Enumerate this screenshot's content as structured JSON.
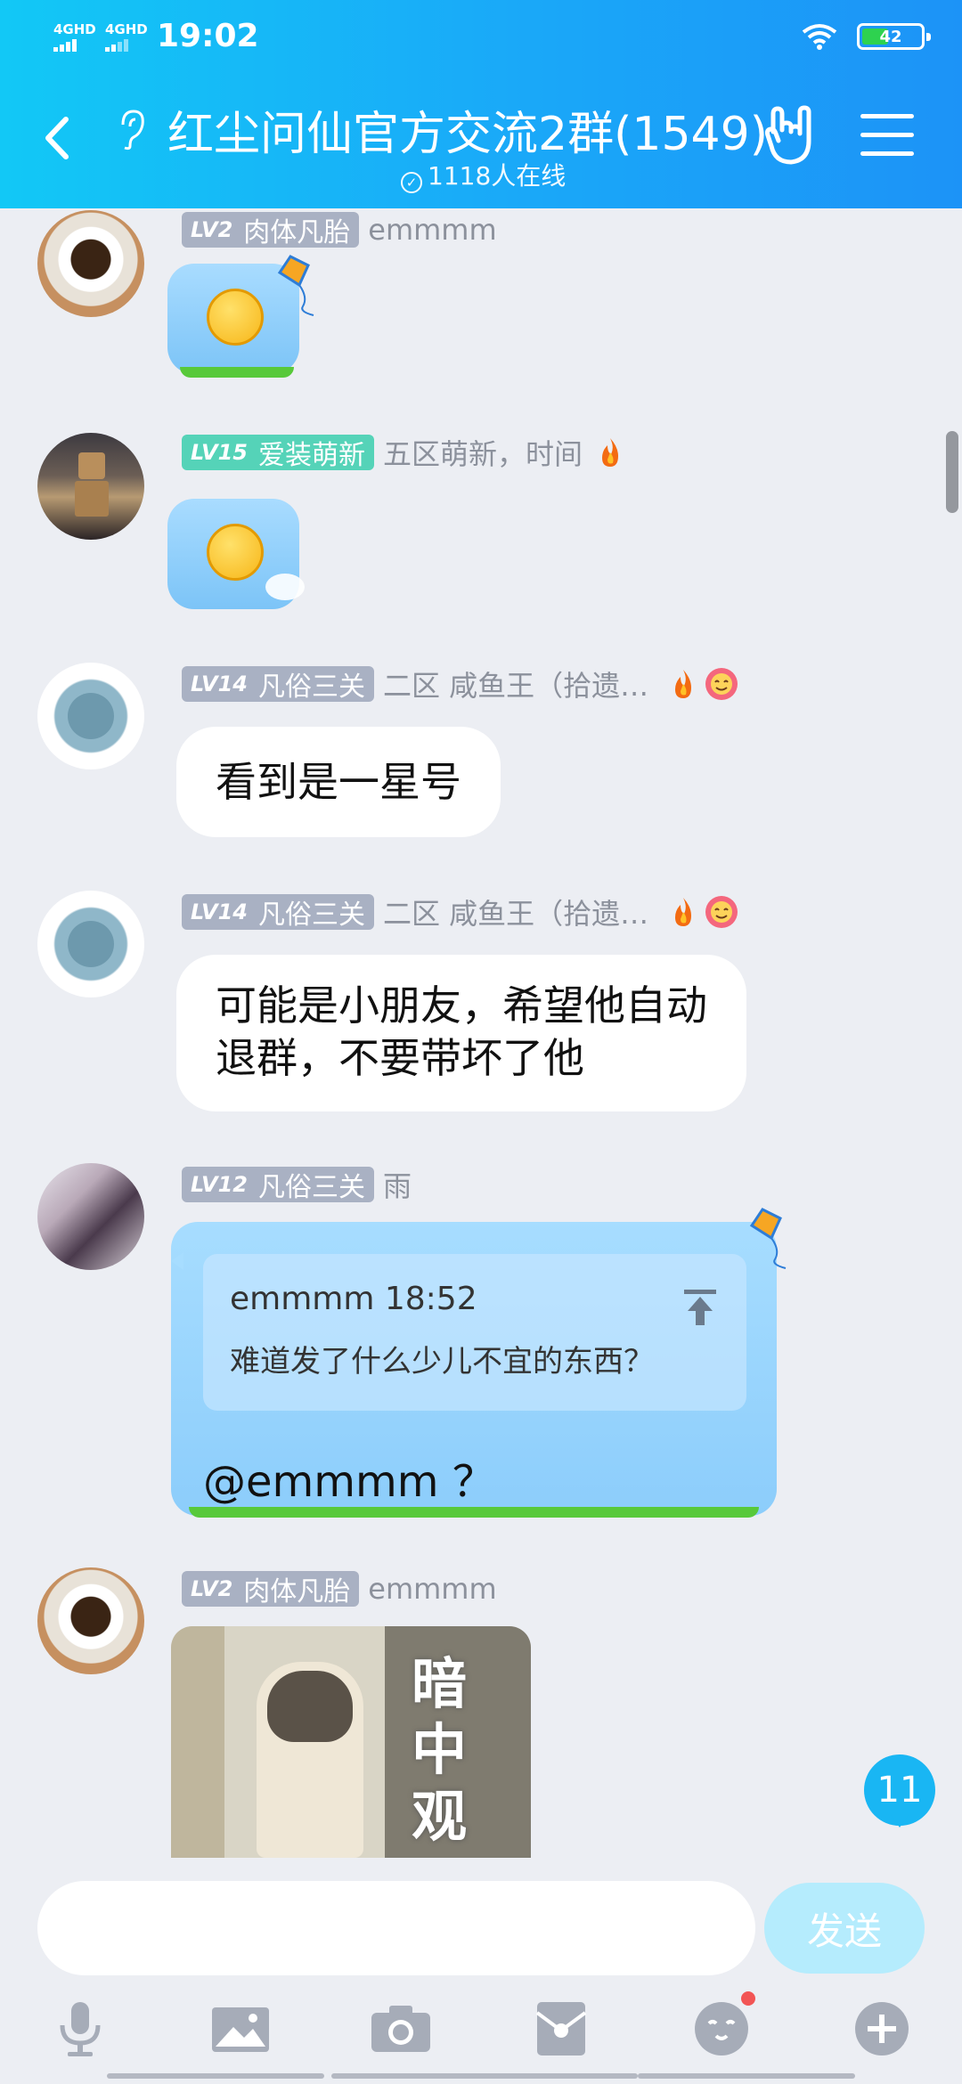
{
  "status_bar": {
    "signal_1": "4GHD",
    "signal_2": "4GHD",
    "time": "19:02",
    "battery": "42"
  },
  "header": {
    "title": "红尘问仙官方交流2群(1549)",
    "online_text": "1118人在线"
  },
  "messages": [
    {
      "level": "LV2",
      "title": "肉体凡胎",
      "nick": "emmmm",
      "type": "sticker"
    },
    {
      "level": "LV15",
      "title": "爱装萌新",
      "nick": "五区萌新，时间",
      "type": "sticker"
    },
    {
      "level": "LV14",
      "title": "凡俗三关",
      "nick": "二区 咸鱼王（拾遗…",
      "text": "看到是一星号"
    },
    {
      "level": "LV14",
      "title": "凡俗三关",
      "nick": "二区 咸鱼王（拾遗…",
      "text_line1": "可能是小朋友，希望他自动",
      "text_line2": "退群，不要带坏了他"
    },
    {
      "level": "LV12",
      "title": "凡俗三关",
      "nick": "雨",
      "quote_head": "emmmm 18:52",
      "quote_text": "难道发了什么少儿不宜的东西？",
      "mention": "@emmmm ？"
    },
    {
      "level": "LV2",
      "title": "肉体凡胎",
      "nick": "emmmm",
      "image_text": "暗中观"
    }
  ],
  "unread_count": "11",
  "input": {
    "placeholder": "",
    "send_label": "发送"
  },
  "toolbar": [
    "mic-icon",
    "image-icon",
    "camera-icon",
    "red-packet-icon",
    "emoji-icon",
    "plus-icon"
  ]
}
